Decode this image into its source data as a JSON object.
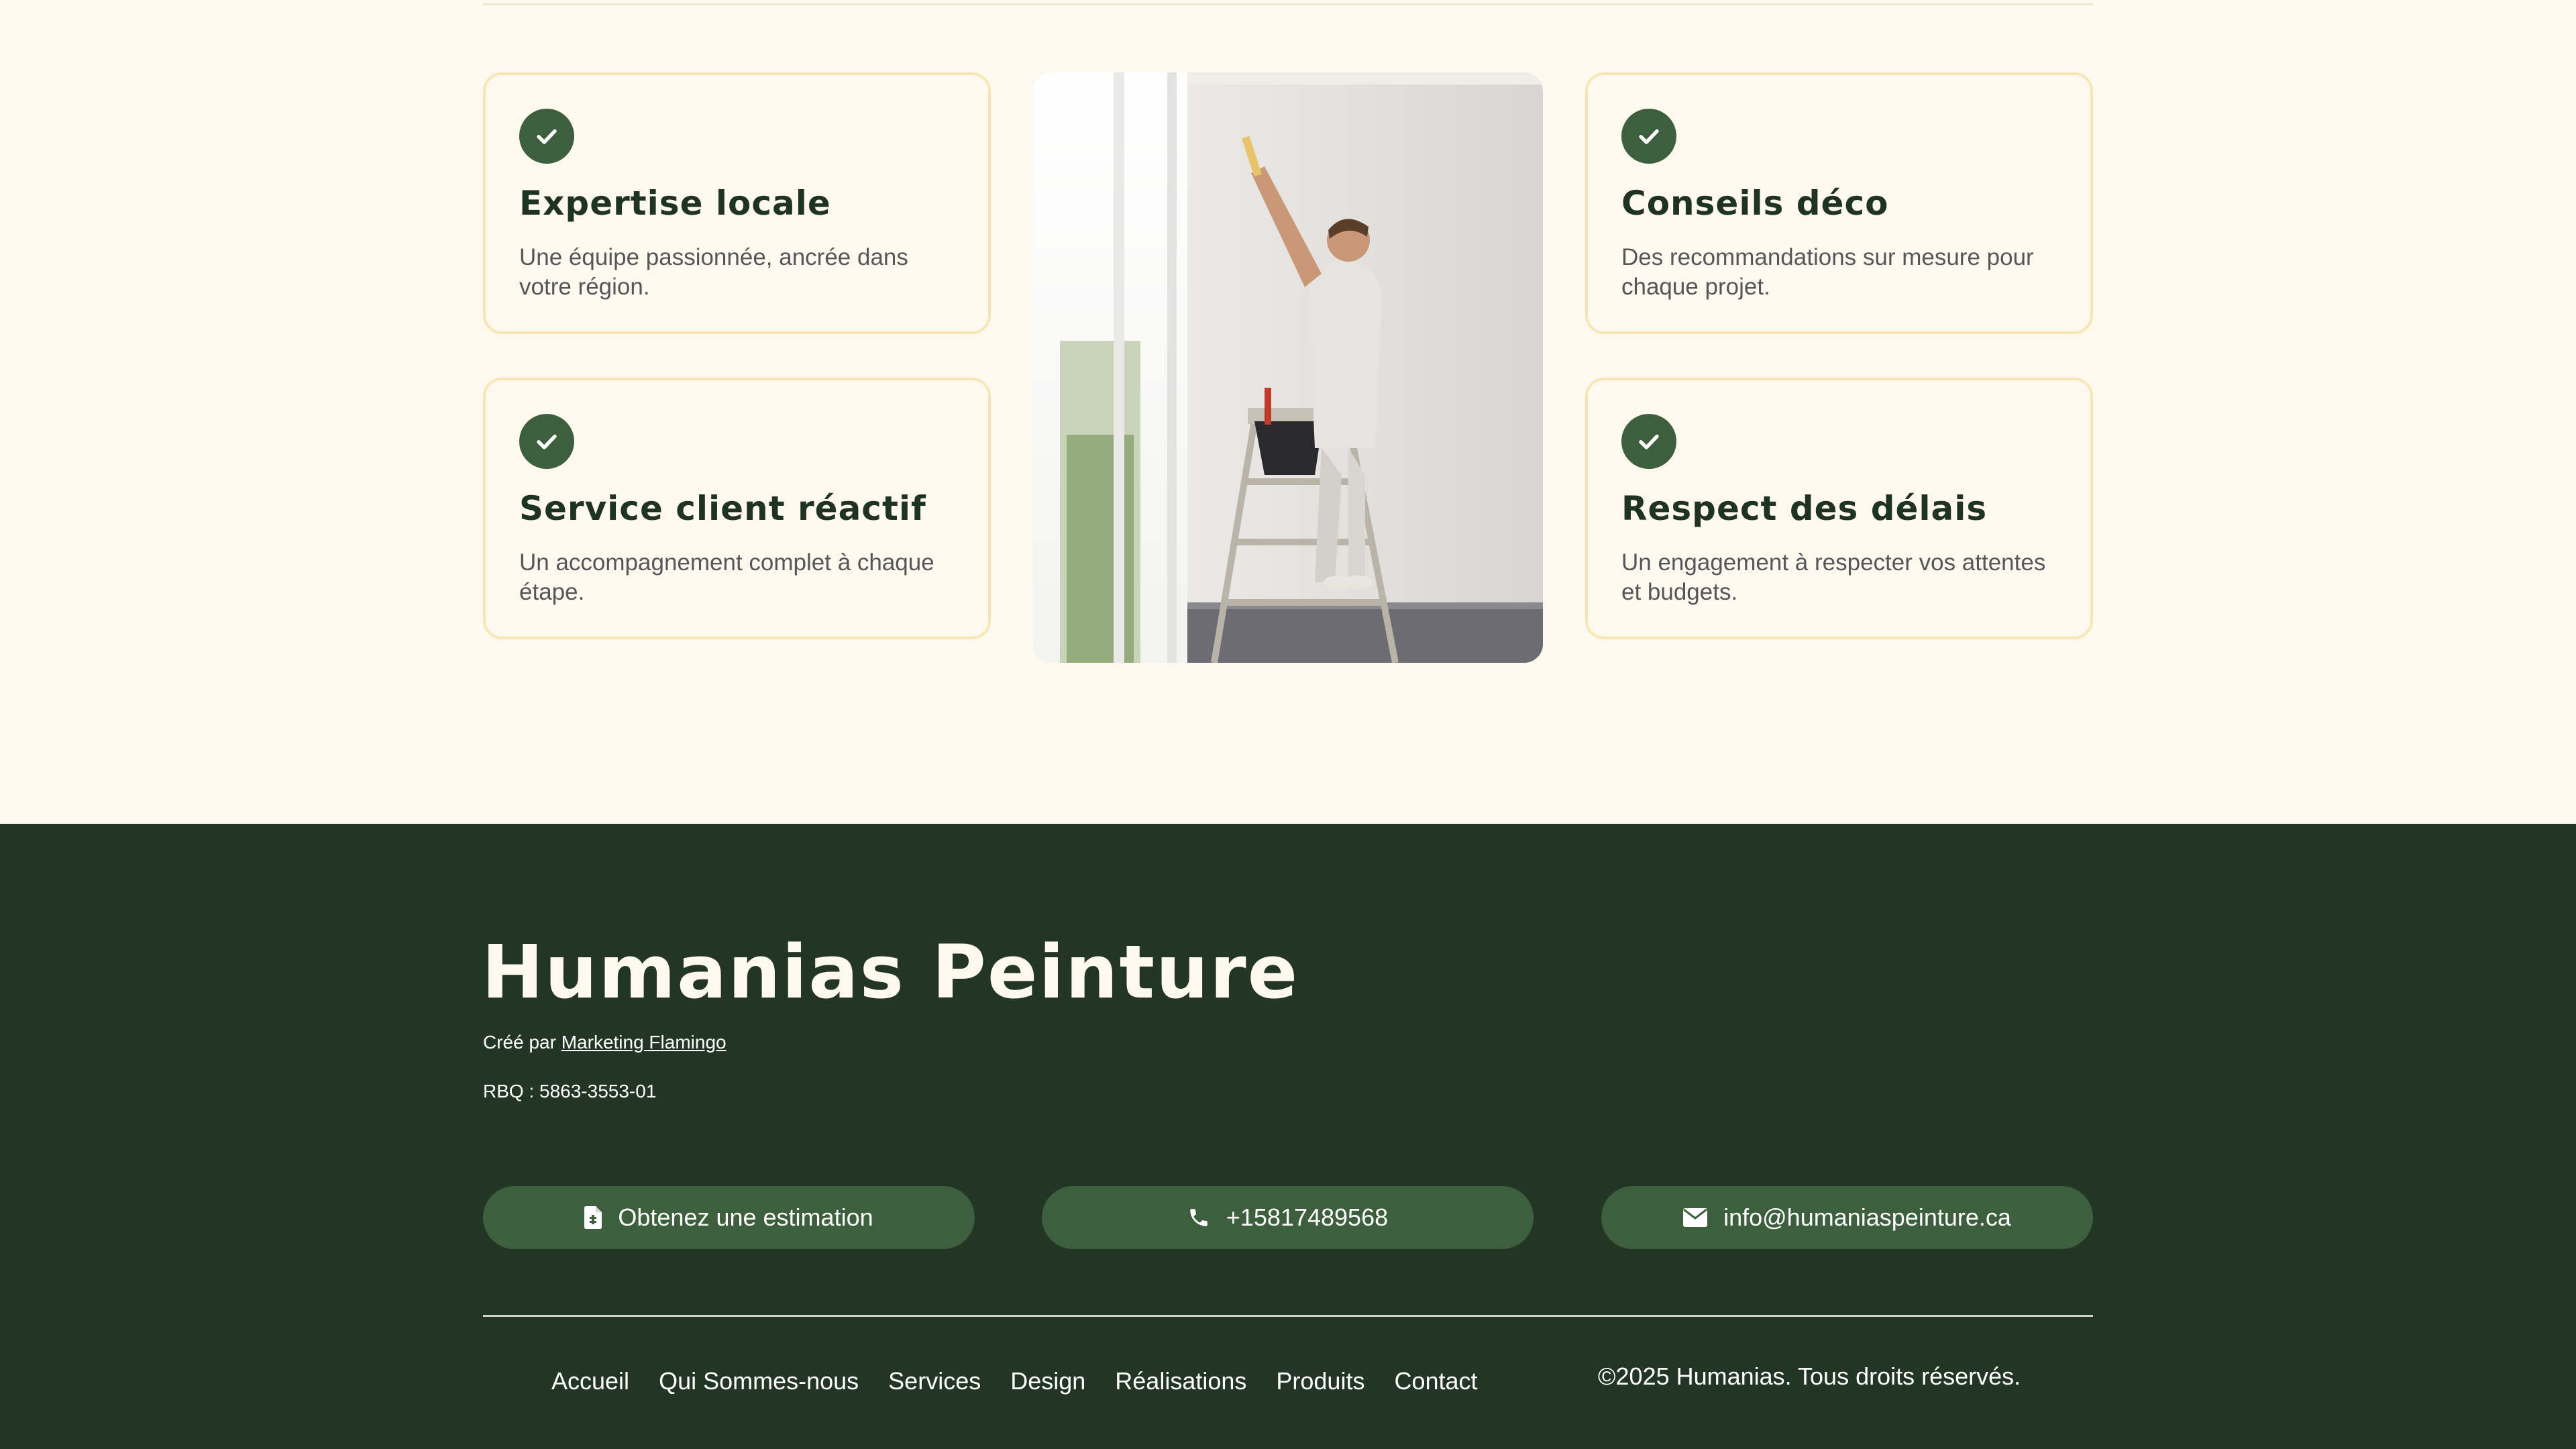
{
  "features": [
    {
      "title": "Expertise locale",
      "text": "Une équipe passionnée, ancrée dans votre région.",
      "icon": "check-icon"
    },
    {
      "title": "Service client réactif",
      "text": "Un accompagnement complet à chaque étape.",
      "icon": "check-icon"
    },
    {
      "title": "Conseils déco",
      "text": "Des recommandations sur mesure pour chaque projet.",
      "icon": "check-icon"
    },
    {
      "title": "Respect des délais",
      "text": "Un engagement à respecter vos attentes et budgets.",
      "icon": "check-icon"
    }
  ],
  "footer": {
    "brand": "Humanias Peinture",
    "credit_prefix": "Créé par ",
    "credit_link": "Marketing Flamingo",
    "rbq": "RBQ : 5863-3553-01",
    "buttons": {
      "estimate": "Obtenez une estimation",
      "phone": "+15817489568",
      "email": "info@humaniaspeinture.ca"
    },
    "nav": [
      "Accueil",
      "Qui Sommes-nous",
      "Services",
      "Design",
      "Réalisations",
      "Produits",
      "Contact"
    ],
    "copyright": "©2025 Humanias. Tous droits réservés."
  },
  "colors": {
    "page_bg": "#fff8ee",
    "card_border": "#f7e7b5",
    "accent_green": "#3e5f3d",
    "footer_bg": "#233524"
  }
}
